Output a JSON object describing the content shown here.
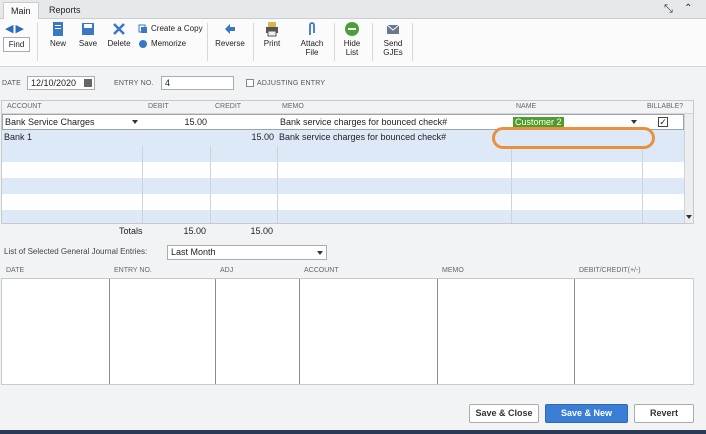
{
  "tabs": [
    {
      "label": "Main"
    },
    {
      "label": "Reports"
    }
  ],
  "toolbar": {
    "find": "Find",
    "new": "New",
    "save": "Save",
    "delete": "Delete",
    "create_copy": "Create a Copy",
    "memorize": "Memorize",
    "reverse": "Reverse",
    "print": "Print",
    "attach_file_1": "Attach",
    "attach_file_2": "File",
    "hide_list_1": "Hide",
    "hide_list_2": "List",
    "send_gjes_1": "Send",
    "send_gjes_2": "GJEs"
  },
  "header": {
    "date_label": "DATE",
    "date_value": "12/10/2020",
    "entry_no_label": "ENTRY NO.",
    "entry_no_value": "4",
    "adjusting_label": "ADJUSTING ENTRY"
  },
  "grid": {
    "columns": [
      "ACCOUNT",
      "DEBIT",
      "CREDIT",
      "MEMO",
      "NAME",
      "BILLABLE?"
    ],
    "rows": [
      {
        "account": "Bank Service Charges",
        "debit": "15.00",
        "credit": "",
        "memo": "Bank service charges for bounced check#",
        "name": "Customer 2",
        "billable": true
      },
      {
        "account": "Bank 1",
        "debit": "",
        "credit": "15.00",
        "memo": "Bank service charges for bounced check#",
        "name": "",
        "billable": false
      }
    ],
    "totals_label": "Totals",
    "total_debit": "15.00",
    "total_credit": "15.00"
  },
  "list": {
    "label": "List of Selected General Journal Entries:",
    "filter": "Last Month",
    "columns": [
      "DATE",
      "ENTRY NO.",
      "ADJ",
      "ACCOUNT",
      "MEMO",
      "DEBIT/CREDIT(+/-)"
    ]
  },
  "footer": {
    "save_close": "Save & Close",
    "save_new": "Save & New",
    "revert": "Revert"
  },
  "colors": {
    "accent": "#3a7fd5",
    "name_tag": "#4f9d2b",
    "highlight": "#e8913c",
    "alt_row": "#dde9f7"
  }
}
